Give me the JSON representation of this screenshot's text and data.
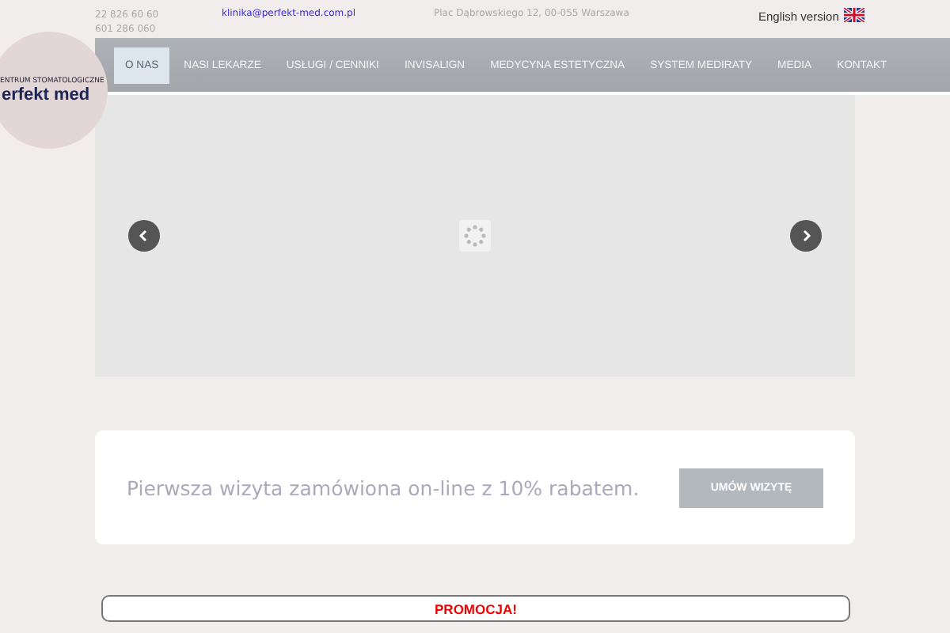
{
  "header": {
    "phones": [
      "22 826 60 60",
      "601 286 060"
    ],
    "email": "klinika@perfekt-med.com.pl",
    "address": "Plac Dąbrowskiego 12, 00-055 Warszawa",
    "language_link": "English version"
  },
  "logo": {
    "tagline": "ENTRUM STOMATOLOGICZNE",
    "name": "erfekt med"
  },
  "nav": [
    {
      "label": "O NAS",
      "selected": true
    },
    {
      "label": "NASI LEKARZE",
      "selected": false
    },
    {
      "label": "USŁUGI / CENNIKI",
      "selected": false
    },
    {
      "label": "INVISALIGN",
      "selected": false
    },
    {
      "label": "MEDYCYNA ESTETYCZNA",
      "selected": false
    },
    {
      "label": "SYSTEM MEDIRATY",
      "selected": false
    },
    {
      "label": "MEDIA",
      "selected": false
    },
    {
      "label": "KONTAKT",
      "selected": false
    }
  ],
  "promo_card": {
    "text": "Pierwsza wizyta zamówiona on-line z 10% rabatem.",
    "button": "UMÓW WIZYTĘ"
  },
  "banner": {
    "text": "PROMOCJA!"
  }
}
